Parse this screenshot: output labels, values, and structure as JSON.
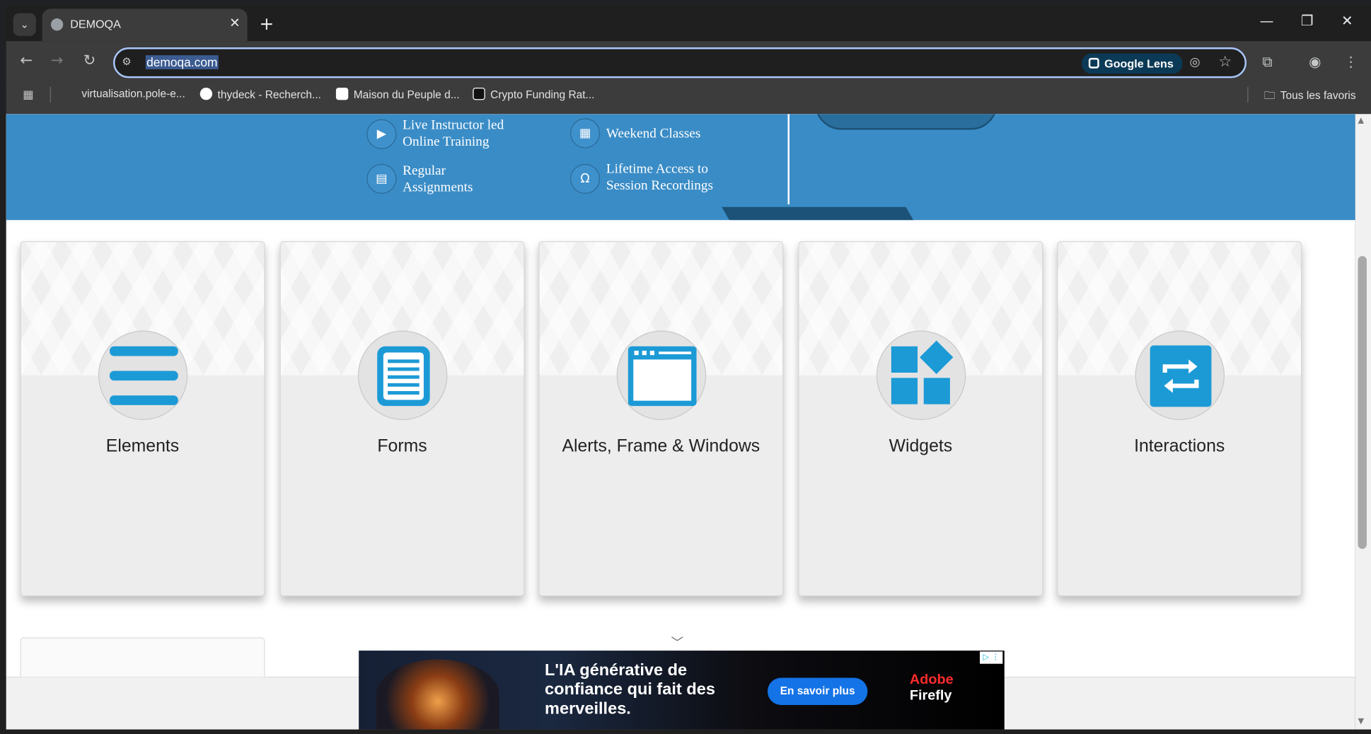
{
  "browser": {
    "tab_title": "DEMOQA",
    "url": "demoqa.com",
    "lens_label": "Google Lens",
    "bookmarks": [
      "virtualisation.pole-e...",
      "thydeck - Recherch...",
      "Maison du Peuple d...",
      "Crypto Funding Rat..."
    ],
    "all_bookmarks_label": "Tous les favoris"
  },
  "banner": {
    "features": [
      {
        "line1": "Live Instructor led",
        "line2": "Online Training"
      },
      {
        "line1": "Weekend Classes",
        "line2": ""
      },
      {
        "line1": "Regular",
        "line2": "Assignments"
      },
      {
        "line1": "Lifetime Access to",
        "line2": "Session Recordings"
      }
    ]
  },
  "cards": [
    {
      "title": "Elements",
      "icon": "elements-icon"
    },
    {
      "title": "Forms",
      "icon": "forms-icon"
    },
    {
      "title": "Alerts, Frame & Windows",
      "icon": "window-icon"
    },
    {
      "title": "Widgets",
      "icon": "widgets-icon"
    },
    {
      "title": "Interactions",
      "icon": "interactions-icon"
    }
  ],
  "ad": {
    "headline_1": "L'IA générative de",
    "headline_2": "confiance qui fait des",
    "headline_3": "merveilles.",
    "button": "En savoir plus",
    "brand_1": "Adobe",
    "brand_2": "Firefly"
  },
  "colors": {
    "accent": "#1c9ad6",
    "banner": "#3a8cc6"
  }
}
